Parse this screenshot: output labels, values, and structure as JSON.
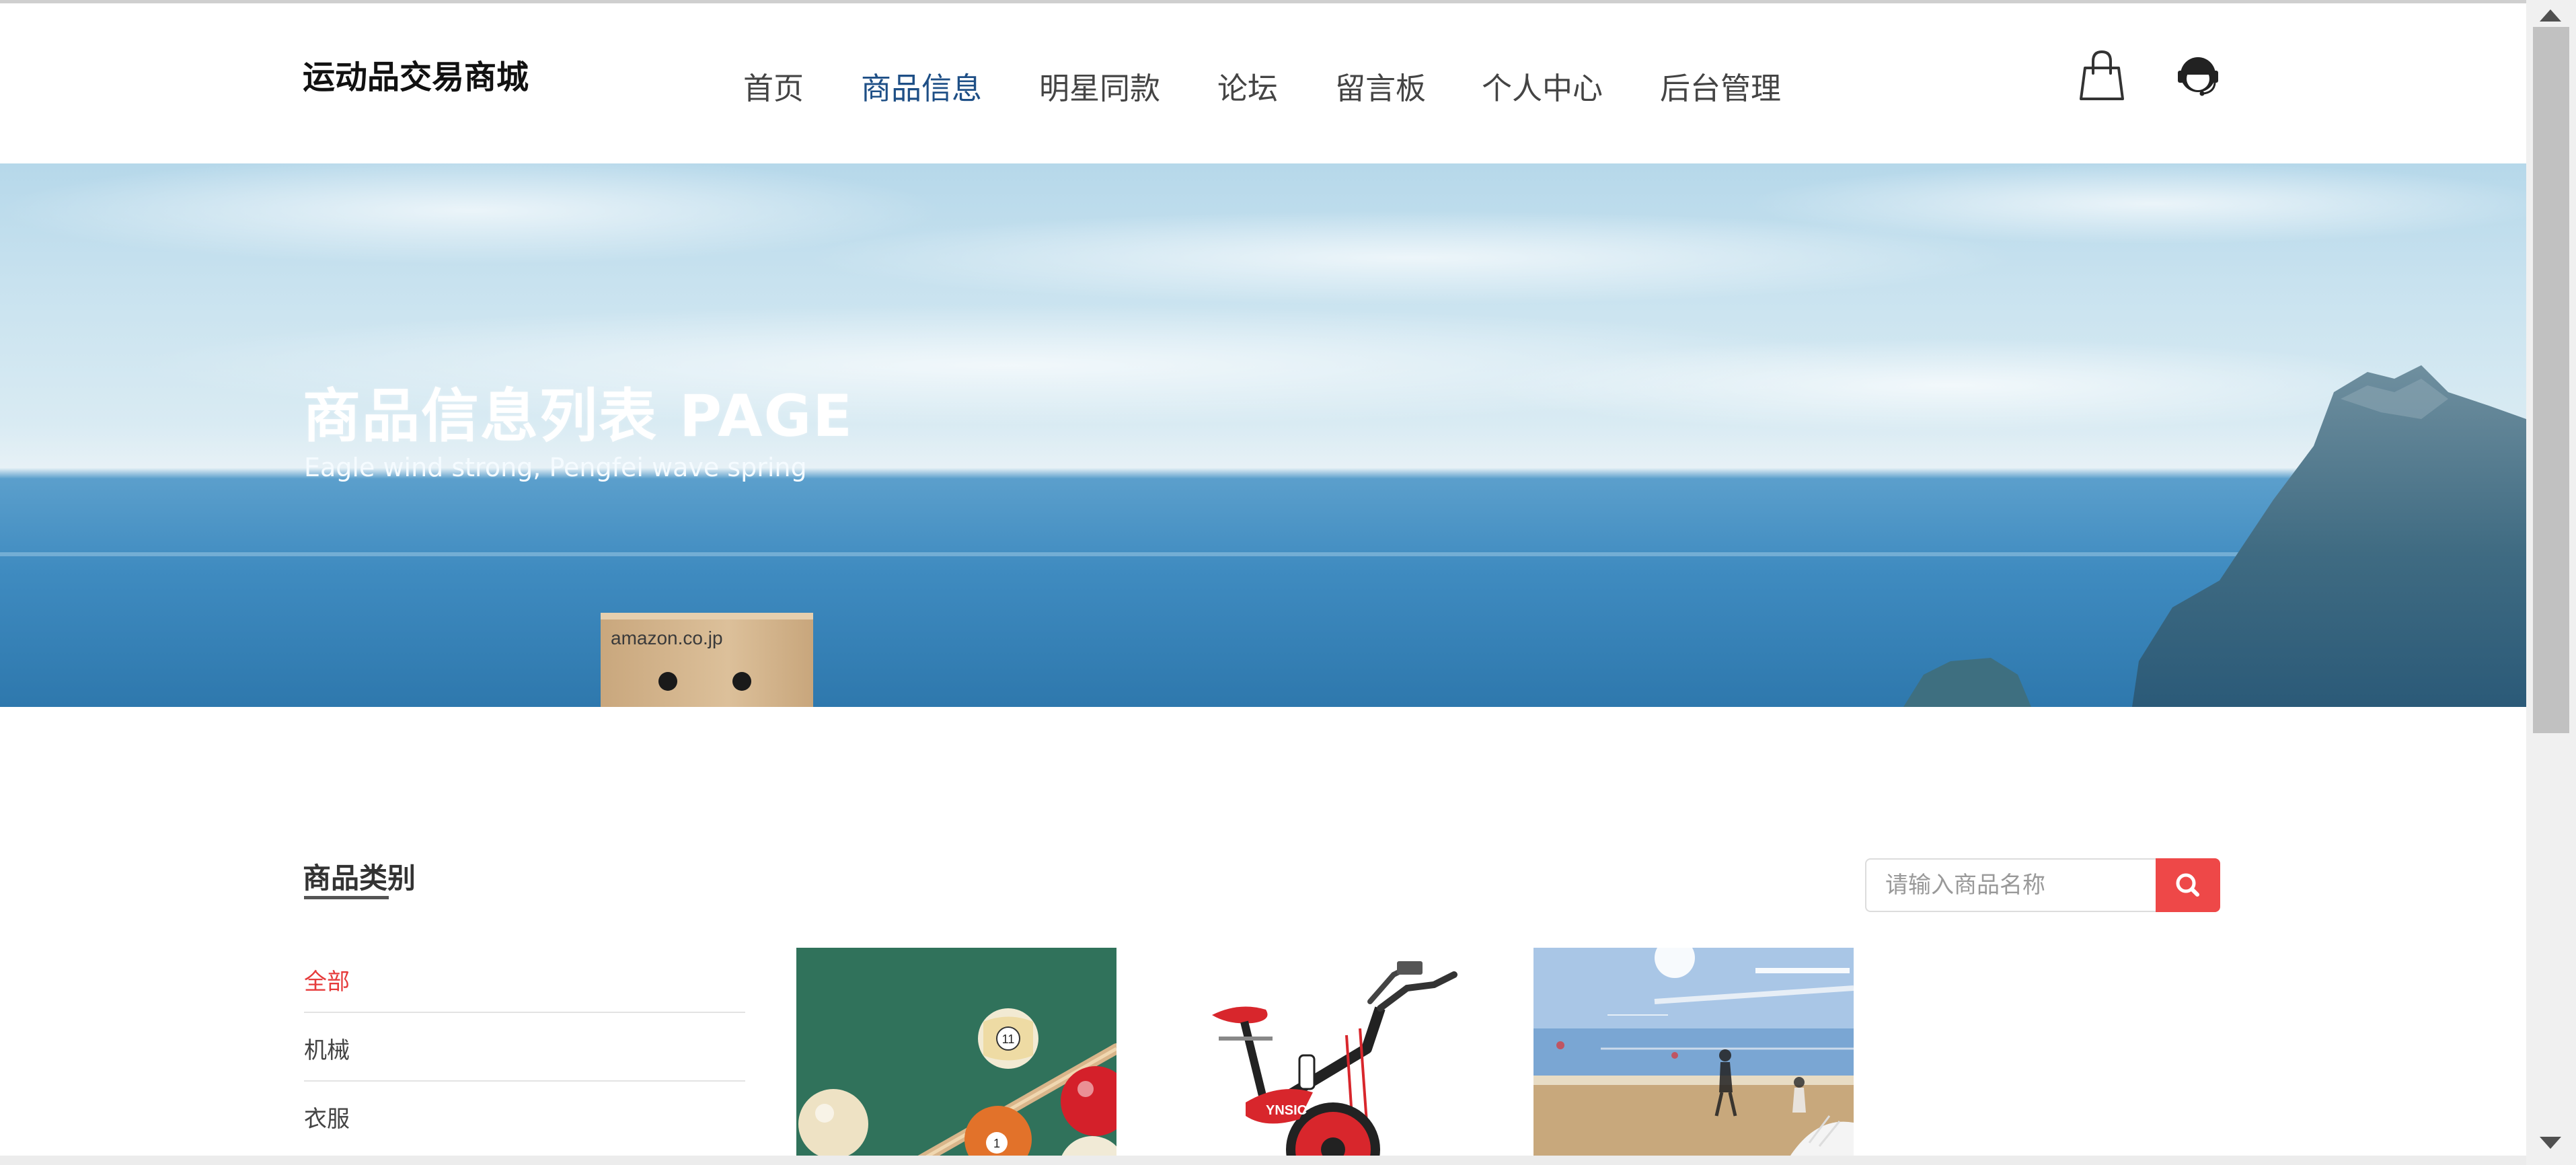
{
  "header": {
    "logo": "运动品交易商城",
    "nav": [
      {
        "label": "首页",
        "active": false
      },
      {
        "label": "商品信息",
        "active": true
      },
      {
        "label": "明星同款",
        "active": false
      },
      {
        "label": "论坛",
        "active": false
      },
      {
        "label": "留言板",
        "active": false
      },
      {
        "label": "个人中心",
        "active": false
      },
      {
        "label": "后台管理",
        "active": false
      }
    ],
    "icons": [
      "shopping-bag-icon",
      "customer-service-icon"
    ],
    "active_color": "#1e4f86"
  },
  "banner": {
    "title": "商品信息列表 PAGE",
    "subtitle": "Eagle wind strong, Pengfei wave spring",
    "box_text": "amazon.co.jp"
  },
  "categories": {
    "title": "商品类别",
    "items": [
      {
        "label": "全部",
        "active": true
      },
      {
        "label": "机械",
        "active": false
      },
      {
        "label": "衣服",
        "active": false
      }
    ],
    "active_color": "#e63b3b"
  },
  "search": {
    "placeholder": "请输入商品名称",
    "button_icon": "search-icon",
    "button_color": "#ee4848"
  },
  "products": [
    {
      "image": "billiard-balls-image"
    },
    {
      "image": "exercise-bike-image"
    },
    {
      "image": "badminton-court-image"
    }
  ]
}
